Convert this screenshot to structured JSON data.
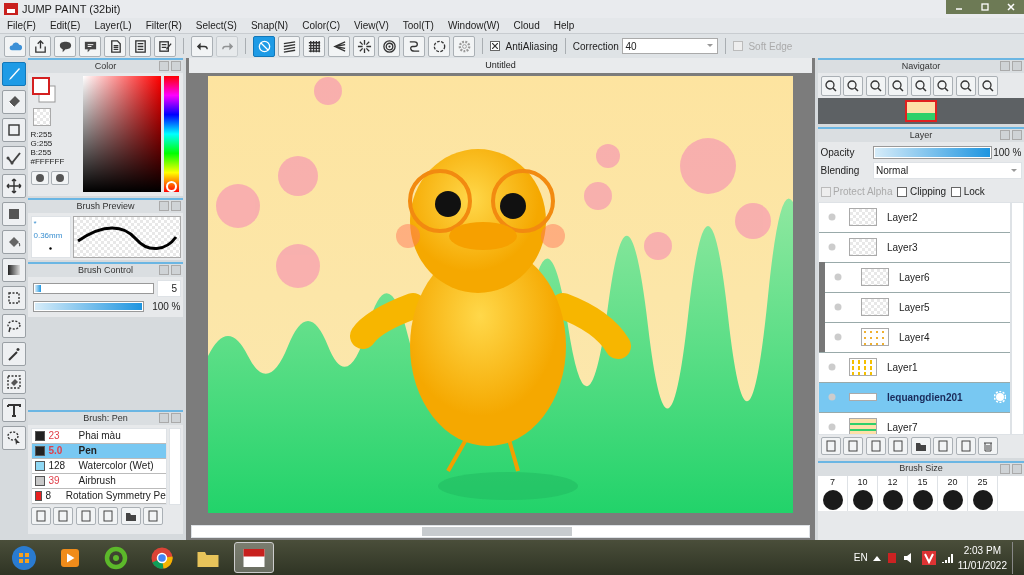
{
  "window": {
    "title": "JUMP PAINT (32bit)"
  },
  "menu": [
    {
      "label": "File(F)"
    },
    {
      "label": "Edit(E)"
    },
    {
      "label": "Layer(L)"
    },
    {
      "label": "Filter(R)"
    },
    {
      "label": "Select(S)"
    },
    {
      "label": "Snap(N)"
    },
    {
      "label": "Color(C)"
    },
    {
      "label": "View(V)"
    },
    {
      "label": "Tool(T)"
    },
    {
      "label": "Window(W)"
    },
    {
      "label": "Cloud"
    },
    {
      "label": "Help"
    }
  ],
  "toolbar": {
    "buttons": [
      {
        "kind": "cloud",
        "selected": false,
        "disabled": false
      },
      {
        "kind": "share",
        "selected": false,
        "disabled": false
      },
      {
        "kind": "speech",
        "selected": false,
        "disabled": false
      },
      {
        "kind": "comment",
        "selected": false,
        "disabled": false
      },
      {
        "kind": "page",
        "selected": false,
        "disabled": false
      },
      {
        "kind": "list",
        "selected": false,
        "disabled": false
      },
      {
        "kind": "checklist",
        "selected": false,
        "disabled": false
      },
      {
        "kind": "undo",
        "selected": false,
        "disabled": false
      },
      {
        "kind": "redo",
        "selected": false,
        "disabled": true
      },
      {
        "kind": "no-ruler",
        "selected": true,
        "disabled": false
      },
      {
        "kind": "parallel",
        "selected": false,
        "disabled": false
      },
      {
        "kind": "grid",
        "selected": false,
        "disabled": false
      },
      {
        "kind": "perspective",
        "selected": false,
        "disabled": false
      },
      {
        "kind": "radial",
        "selected": false,
        "disabled": false
      },
      {
        "kind": "concentric",
        "selected": false,
        "disabled": false
      },
      {
        "kind": "curve",
        "selected": false,
        "disabled": false
      },
      {
        "kind": "ellipse",
        "selected": false,
        "disabled": false
      },
      {
        "kind": "settings",
        "selected": false,
        "disabled": false
      }
    ],
    "antialiasing": {
      "label": "AntiAliasing",
      "checked": true
    },
    "correction": {
      "label": "Correction",
      "value": "40"
    },
    "soft_edge": {
      "label": "Soft Edge",
      "checked": false,
      "disabled": true
    }
  },
  "tools": [
    {
      "kind": "brush",
      "selected": true
    },
    {
      "kind": "eraser",
      "selected": false
    },
    {
      "kind": "rectangle",
      "selected": false
    },
    {
      "kind": "polyline",
      "selected": false
    },
    {
      "kind": "move",
      "selected": false
    },
    {
      "kind": "fill",
      "selected": false
    },
    {
      "kind": "bucket",
      "selected": false
    },
    {
      "kind": "gradient",
      "selected": false
    },
    {
      "kind": "select-rect",
      "selected": false
    },
    {
      "kind": "lasso",
      "selected": false
    },
    {
      "kind": "wand",
      "selected": false
    },
    {
      "kind": "select-eraser",
      "selected": false
    },
    {
      "kind": "text",
      "selected": false
    },
    {
      "kind": "select-pen",
      "selected": false
    }
  ],
  "color_panel": {
    "title": "Color",
    "hue": {
      "level": 0
    },
    "r": "R:255",
    "g": "G:255",
    "b": "B:255",
    "hex": "#FFFFFF"
  },
  "brush_preview": {
    "title": "Brush Preview",
    "size": "* 0.36mm"
  },
  "brush_control": {
    "title": "Brush Control",
    "size": {
      "level": 0.05,
      "value": "5"
    },
    "opacity": {
      "level": 1,
      "reading": "100 %"
    }
  },
  "brush_list": {
    "title": "Brush: Pen",
    "items": [
      {
        "color": "#222222",
        "size": "23",
        "name": "Phai màu",
        "modified": true,
        "selected": false
      },
      {
        "color": "#222222",
        "size": "5.0",
        "name": "Pen",
        "modified": true,
        "selected": true
      },
      {
        "color": "#8fd8f4",
        "size": "128",
        "name": "Watercolor (Wet)",
        "modified": false,
        "selected": false
      },
      {
        "color": "#c8c8c8",
        "size": "39",
        "name": "Airbrush",
        "modified": true,
        "selected": false
      },
      {
        "color": "#e82020",
        "size": "8",
        "name": "Rotation Symmetry Pe",
        "modified": false,
        "selected": false
      }
    ]
  },
  "document": {
    "tab": "Untitled"
  },
  "navigator": {
    "title": "Navigator"
  },
  "layer_panel": {
    "title": "Layer",
    "opacity_label": "Opacity",
    "opacity": {
      "level": 1,
      "reading": "100 %"
    },
    "blending_label": "Blending",
    "blending": "Normal",
    "options": [
      {
        "label": "Protect Alpha",
        "checked": false,
        "disabled": true
      },
      {
        "label": "Clipping",
        "checked": false,
        "disabled": false
      },
      {
        "label": "Lock",
        "checked": false,
        "disabled": false
      }
    ],
    "layers": [
      {
        "name": "Layer2",
        "selected": false,
        "clipped": false,
        "kind": "blank"
      },
      {
        "name": "Layer3",
        "selected": false,
        "clipped": false,
        "kind": "blank"
      },
      {
        "name": "Layer6",
        "selected": false,
        "clipped": true,
        "kind": "blank"
      },
      {
        "name": "Layer5",
        "selected": false,
        "clipped": true,
        "kind": "blank"
      },
      {
        "name": "Layer4",
        "selected": false,
        "clipped": true,
        "kind": "spot"
      },
      {
        "name": "Layer1",
        "selected": false,
        "clipped": false,
        "kind": "duck"
      },
      {
        "name": "lequangdien201",
        "selected": true,
        "clipped": false,
        "kind": "strip"
      },
      {
        "name": "Layer7",
        "selected": false,
        "clipped": false,
        "kind": "scene"
      }
    ]
  },
  "brush_size": {
    "title": "Brush Size",
    "sizes": [
      "7",
      "10",
      "12",
      "15",
      "20",
      "25"
    ]
  },
  "taskbar": {
    "apps": [
      {
        "kind": "media",
        "selected": false
      },
      {
        "kind": "coccoc",
        "selected": false
      },
      {
        "kind": "chrome",
        "selected": false
      },
      {
        "kind": "folder",
        "selected": false
      },
      {
        "kind": "jumppaint",
        "selected": true
      }
    ],
    "language": "EN",
    "time": "2:03 PM",
    "date": "11/01/2022"
  }
}
